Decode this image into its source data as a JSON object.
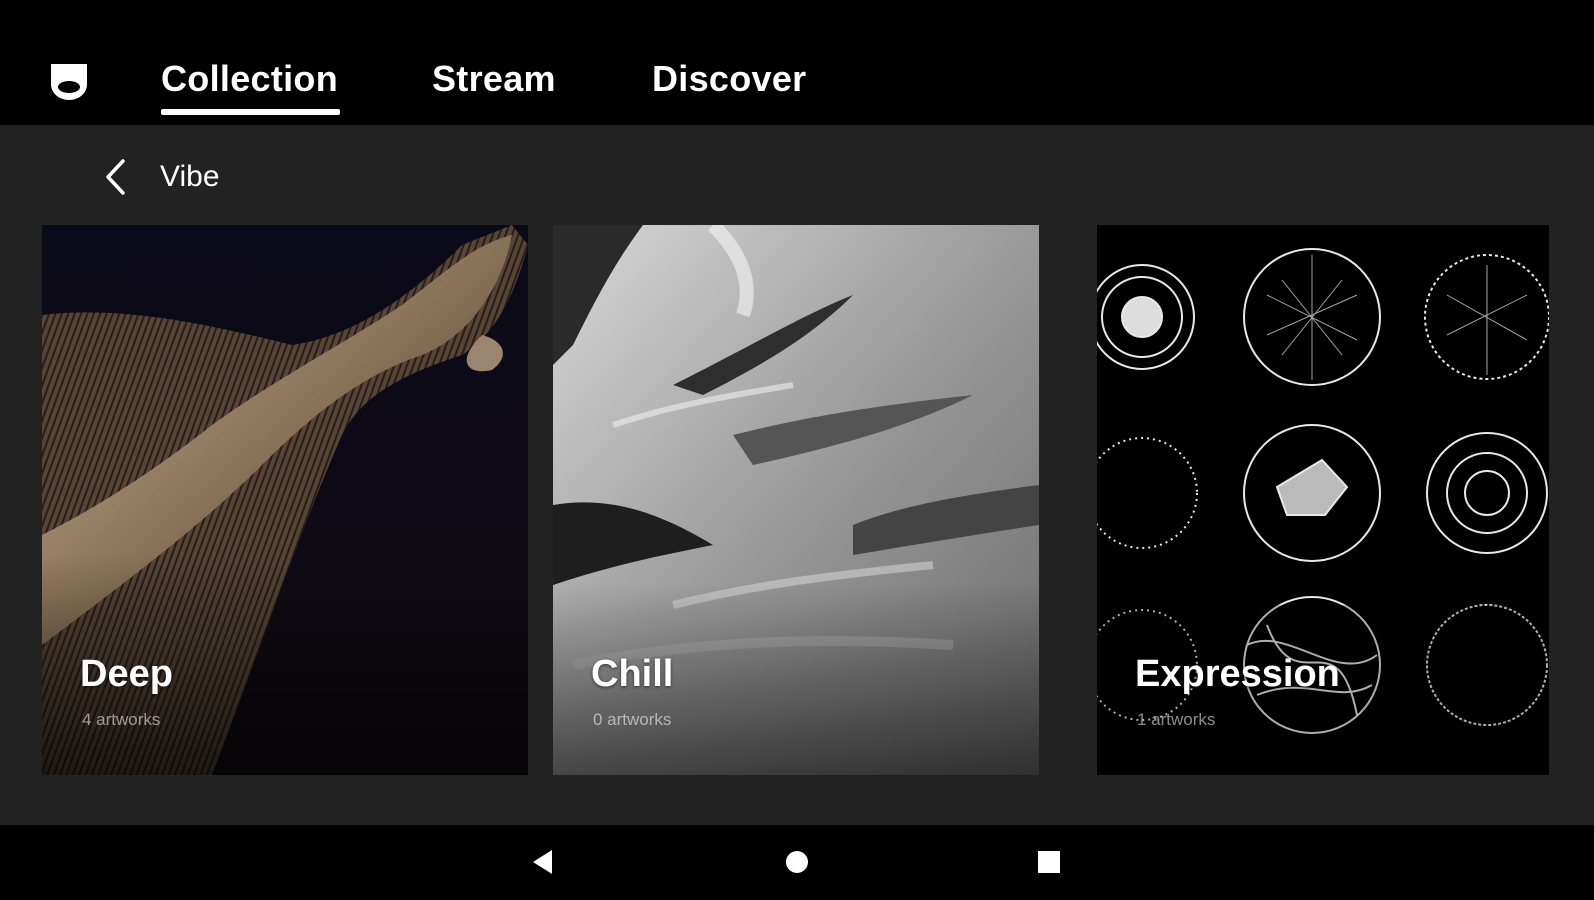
{
  "header": {
    "logo_icon": "shield-logo-icon",
    "tabs": [
      {
        "label": "Collection",
        "active": true
      },
      {
        "label": "Stream",
        "active": false
      },
      {
        "label": "Discover",
        "active": false
      }
    ]
  },
  "breadcrumb": {
    "back_icon": "chevron-left-icon",
    "title": "Vibe"
  },
  "cards": [
    {
      "title": "Deep",
      "count": "4 artworks"
    },
    {
      "title": "Chill",
      "count": "0 artworks"
    },
    {
      "title": "Expression",
      "count": "1 artworks"
    }
  ],
  "system_nav": {
    "back_icon": "triangle-back-icon",
    "home_icon": "circle-home-icon",
    "recents_icon": "square-recents-icon"
  },
  "colors": {
    "background": "#222222",
    "bars": "#000000",
    "text": "#ffffff"
  }
}
